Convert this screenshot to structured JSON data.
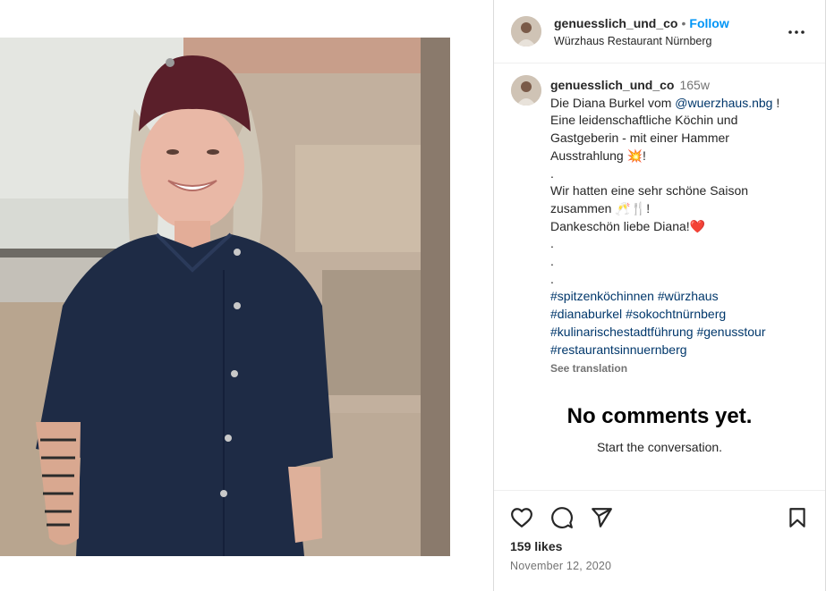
{
  "post": {
    "username": "genuesslich_und_co",
    "separator": "•",
    "follow_label": "Follow",
    "location": "Würzhaus Restaurant Nürnberg",
    "more_icon": "more-horizontal-icon"
  },
  "caption": {
    "username": "genuesslich_und_co",
    "time_ago": "165w",
    "line1_pre": "Die Diana Burkel vom ",
    "line1_mention": "@wuerzhaus.nbg",
    "line1_post": " !",
    "line2": "Eine leidenschaftliche Köchin und",
    "line3": "Gastgeberin - mit einer Hammer",
    "line4": "Ausstrahlung ",
    "line4_emoji": "💥",
    "line4_post": "!",
    "line5": ".",
    "line6": "Wir hatten eine sehr schöne Saison",
    "line7": "zusammen ",
    "line7_emoji": "🥂🍴",
    "line7_post": "!",
    "line8": "Dankeschön liebe Diana!",
    "line8_emoji": "❤️",
    "line9": ".",
    "line10": ".",
    "line11": ".",
    "hashtags": [
      [
        "#spitzenköchinnen",
        "#würzhaus"
      ],
      [
        "#dianaburkel",
        "#sokochtnürnberg"
      ],
      [
        "#kulinarischestadtführung",
        "#genusstour"
      ],
      [
        "#restaurantsinnuernberg"
      ]
    ],
    "see_translation": "See translation"
  },
  "comments": {
    "empty_title": "No comments yet.",
    "empty_subtitle": "Start the conversation."
  },
  "actions": {
    "icons": [
      "heart-icon",
      "comment-icon",
      "share-icon",
      "bookmark-icon"
    ],
    "likes": "159 likes",
    "date": "November 12, 2020"
  },
  "colors": {
    "link_blue": "#0095f6",
    "hashtag": "#00376b",
    "muted": "#737373",
    "border": "#dbdbdb"
  }
}
